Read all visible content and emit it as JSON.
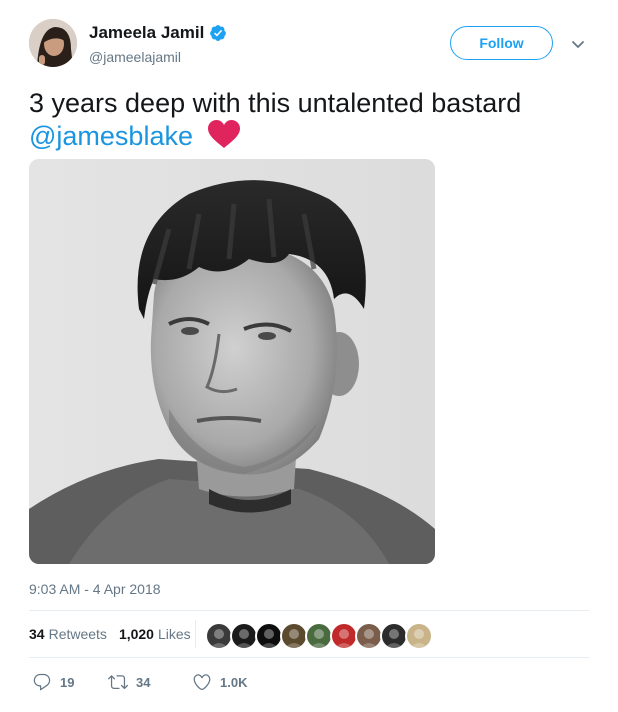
{
  "user": {
    "display_name": "Jameela Jamil",
    "handle": "@jameelajamil",
    "verified": true
  },
  "follow_label": "Follow",
  "tweet": {
    "text": "3 years deep with this untalented bastard",
    "mention": "@jamesblake",
    "emoji": "red-heart",
    "timestamp": "9:03 AM - 4 Apr 2018"
  },
  "stats": {
    "retweets_count": "34",
    "retweets_label": "Retweets",
    "likes_count": "1,020",
    "likes_label": "Likes"
  },
  "actions": {
    "replies": "19",
    "retweets": "34",
    "likes": "1.0K"
  },
  "colors": {
    "accent": "#1da1f2",
    "mention": "#1b95e0",
    "secondary_text": "#657786",
    "divider": "#e6ecf0",
    "heart": "#e0245e"
  },
  "liker_avatars": [
    "#3a3a3a",
    "#1b1b1b",
    "#0d0d0d",
    "#5b4a2e",
    "#4a6b3f",
    "#c02a2a",
    "#7a5d4a",
    "#2c2c2c",
    "#c9b48a"
  ]
}
